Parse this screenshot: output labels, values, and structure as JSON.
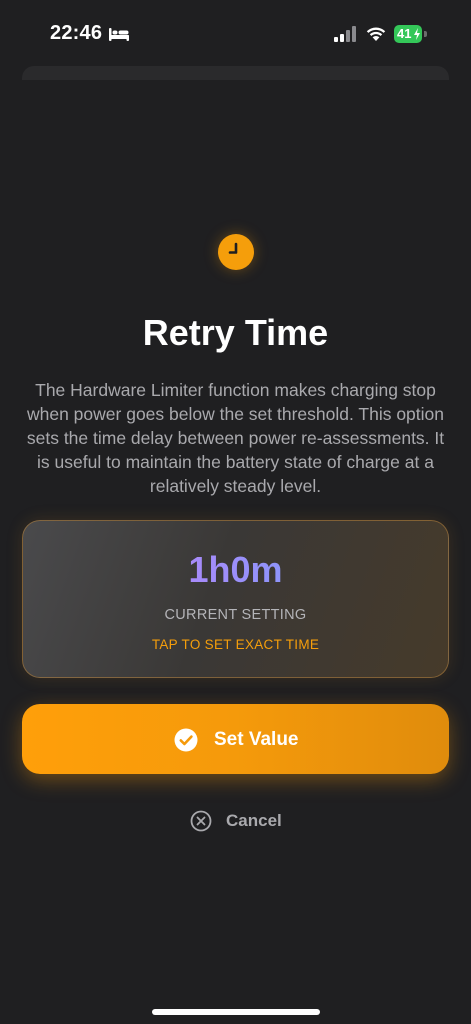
{
  "status_bar": {
    "time": "22:46",
    "battery_level": "41"
  },
  "dialog": {
    "title": "Retry Time",
    "description": "The Hardware Limiter function makes charging stop when power goes below the set threshold. This option sets the time delay between power re-assessments. It is useful to maintain the battery state of charge at a relatively steady level.",
    "current_value": "1h0m",
    "current_label": "CURRENT SETTING",
    "tap_hint": "TAP TO SET EXACT TIME",
    "set_button_label": "Set Value",
    "cancel_label": "Cancel"
  },
  "icons": {
    "header": "clock-icon",
    "set": "checkmark-circle-icon",
    "cancel": "x-circle-icon",
    "sleep": "bed-icon"
  },
  "colors": {
    "accent": "#f59e0b",
    "background": "#1f1f21",
    "battery": "#34c759",
    "value_gradient_start": "#c084fc",
    "value_gradient_end": "#60a5fa"
  }
}
